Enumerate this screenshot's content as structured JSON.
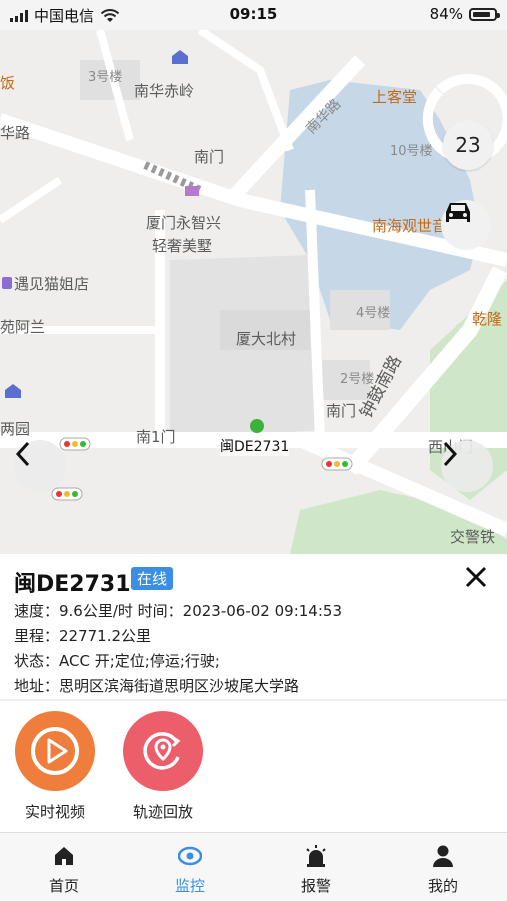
{
  "status_bar": {
    "carrier": "中国电信",
    "time": "09:15",
    "battery": "84%",
    "battery_level": 0.84
  },
  "map": {
    "labels": [
      {
        "text": "饭",
        "style": "orange",
        "name": "map-label-fan"
      },
      {
        "text": "3号楼",
        "style": "small",
        "name": "map-label-building-3"
      },
      {
        "text": "南华赤岭",
        "style": "normal",
        "name": "map-label-nanhuachiling"
      },
      {
        "text": "上客堂",
        "style": "orange",
        "name": "map-label-shangketang"
      },
      {
        "text": "华路",
        "style": "normal",
        "name": "map-label-hualu"
      },
      {
        "text": "南华路",
        "style": "small",
        "name": "map-label-nanhualu"
      },
      {
        "text": "南门",
        "style": "normal",
        "name": "map-label-nanmen-top"
      },
      {
        "text": "10号楼",
        "style": "small",
        "name": "map-label-building-10"
      },
      {
        "text": "厦门永智兴",
        "style": "normal",
        "name": "map-label-xiamen-yongzhixing"
      },
      {
        "text": "轻奢美墅",
        "style": "normal",
        "name": "map-label-qingshe-meishu"
      },
      {
        "text": "南海观世音菩萨",
        "style": "orange",
        "name": "map-label-nanhai-guanshiyin"
      },
      {
        "text": "遇见猫姐店",
        "style": "normal",
        "name": "map-label-yujian-maojie"
      },
      {
        "text": "4号楼",
        "style": "small",
        "name": "map-label-building-4"
      },
      {
        "text": "乾隆",
        "style": "orange",
        "name": "map-label-qianlong"
      },
      {
        "text": "苑阿兰",
        "style": "normal",
        "name": "map-label-yuanalan"
      },
      {
        "text": "厦大北村",
        "style": "normal",
        "name": "map-label-xiada-beicun"
      },
      {
        "text": "2号楼",
        "style": "small",
        "name": "map-label-building-2"
      },
      {
        "text": "两园",
        "style": "normal",
        "name": "map-label-liangyuan"
      },
      {
        "text": "南门",
        "style": "normal",
        "name": "map-label-nanmen-bottom"
      },
      {
        "text": "钟鼓南路",
        "style": "normal",
        "name": "map-label-zhonggu-nanlu"
      },
      {
        "text": "南1门",
        "style": "normal",
        "name": "map-label-nan1men"
      },
      {
        "text": "西山门",
        "style": "normal",
        "name": "map-label-xishanmen"
      },
      {
        "text": "交警铁",
        "style": "normal",
        "name": "map-label-jiaojingtie"
      }
    ],
    "vehicle_plate": "闽DE2731",
    "zoom_level": "23",
    "prev_icon": "chevron-left-icon",
    "next_icon": "chevron-right-icon",
    "car_icon": "car-icon"
  },
  "vehicle": {
    "plate": "闽DE2731",
    "status_badge": "在线",
    "speed_line": "速度：9.6公里/时 时间：2023-06-02 09:14:53",
    "mileage_line": "里程：22771.2公里",
    "state_line": "状态：ACC 开;定位;停运;行驶;",
    "address_line": "地址：思明区滨海街道思明区沙坡尾大学路"
  },
  "actions": {
    "realtime_video": "实时视频",
    "track_playback": "轨迹回放"
  },
  "tabs": [
    {
      "label": "首页",
      "icon": "home-icon"
    },
    {
      "label": "监控",
      "icon": "eye-icon"
    },
    {
      "label": "报警",
      "icon": "alarm-icon"
    },
    {
      "label": "我的",
      "icon": "user-icon"
    }
  ],
  "colors": {
    "accent": "#3a8ee6",
    "video_orange": "#ef7d3c",
    "track_red": "#ec5f6a"
  }
}
